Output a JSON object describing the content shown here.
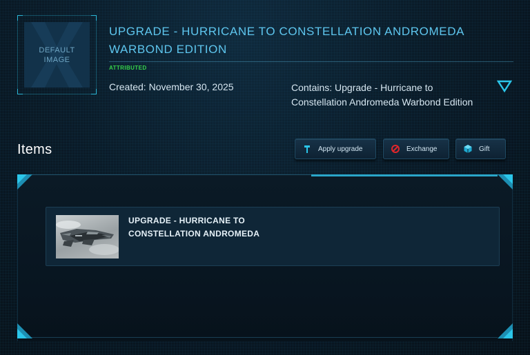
{
  "pledge": {
    "thumbnail_text": "DEFAULT IMAGE",
    "title": "UPGRADE - HURRICANE TO CONSTELLATION ANDROMEDA WARBOND EDITION",
    "status_badge": "ATTRIBUTED",
    "created": "Created: November 30, 2025",
    "contains": "Contains: Upgrade - Hurricane to Constellation Andromeda Warbond Edition"
  },
  "items_section": {
    "heading": "Items",
    "actions": {
      "apply_label": "Apply upgrade",
      "exchange_label": "Exchange",
      "gift_label": "Gift"
    },
    "list": [
      {
        "name": "UPGRADE - HURRICANE TO CONSTELLATION ANDROMEDA",
        "icon": "ship-thumbnail"
      }
    ]
  },
  "colors": {
    "accent": "#5ec6ee",
    "status_green": "#36d24a",
    "background": "#08131d"
  }
}
